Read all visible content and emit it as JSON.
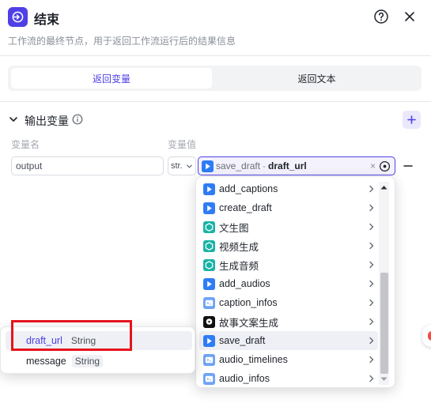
{
  "header": {
    "title": "结束",
    "description": "工作流的最终节点，用于返回工作流运行后的结果信息"
  },
  "tabs": [
    {
      "label": "返回变量",
      "active": true
    },
    {
      "label": "返回文本",
      "active": false
    }
  ],
  "output_section": {
    "title": "输出变量",
    "col_name": "变量名",
    "col_value": "变量值",
    "row": {
      "name": "output",
      "type": "str.",
      "value_node": "save_draft",
      "value_sep": "-",
      "value_field": "draft_url",
      "clear": "×"
    }
  },
  "dropdown": {
    "items": [
      {
        "label": "add_captions",
        "icon": "plugin-blue",
        "active": false
      },
      {
        "label": "create_draft",
        "icon": "plugin-blue",
        "active": false
      },
      {
        "label": "文生图",
        "icon": "plugin-teal",
        "active": false
      },
      {
        "label": "视频生成",
        "icon": "plugin-teal",
        "active": false
      },
      {
        "label": "生成音频",
        "icon": "plugin-teal",
        "active": false
      },
      {
        "label": "add_audios",
        "icon": "plugin-blue",
        "active": false
      },
      {
        "label": "caption_infos",
        "icon": "code-blue",
        "active": false
      },
      {
        "label": "故事文案生成",
        "icon": "llm-black",
        "active": false
      },
      {
        "label": "save_draft",
        "icon": "plugin-blue",
        "active": true
      },
      {
        "label": "audio_timelines",
        "icon": "code-blue",
        "active": false
      },
      {
        "label": "audio_infos",
        "icon": "code-blue",
        "active": false
      }
    ]
  },
  "sub_popup": {
    "items": [
      {
        "name": "draft_url",
        "type": "String",
        "active": true
      },
      {
        "name": "message",
        "type": "String",
        "active": false
      }
    ]
  },
  "colors": {
    "accent": "#4e40e5",
    "highlight": "#e5141e"
  }
}
